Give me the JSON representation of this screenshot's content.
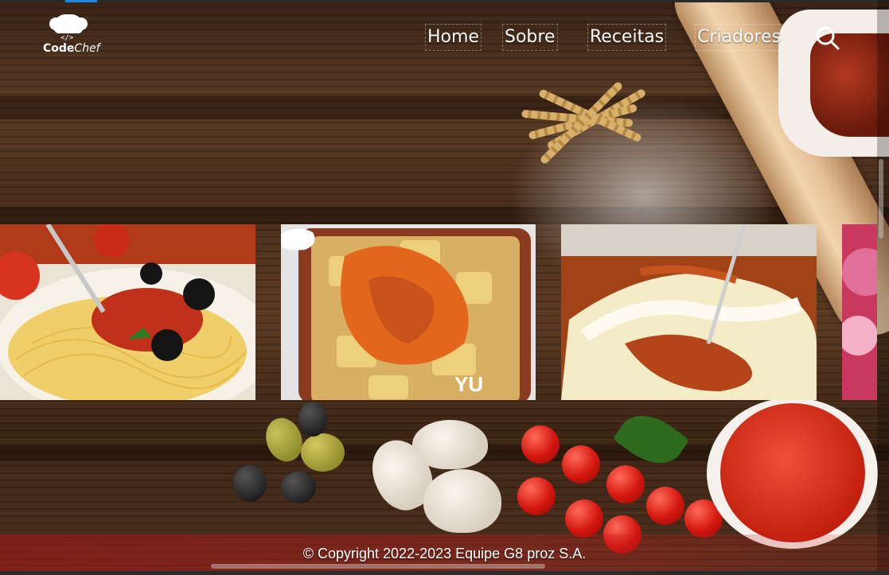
{
  "brand": {
    "logo_text_bold": "Code",
    "logo_text_light": "Chef",
    "logo_code_symbol": "</>"
  },
  "nav": {
    "items": [
      {
        "label": "Home"
      },
      {
        "label": "Sobre"
      },
      {
        "label": "Receitas"
      },
      {
        "label": "Criadores"
      }
    ],
    "search_icon": "search-icon"
  },
  "gallery": {
    "cards": [
      {
        "name": "spaghetti-photo",
        "overlay_text": ""
      },
      {
        "name": "patatas-bravas-photo",
        "overlay_text": "YU"
      },
      {
        "name": "pasta-bake-photo",
        "overlay_text": ""
      },
      {
        "name": "partial-dessert-photo",
        "overlay_text": ""
      }
    ]
  },
  "footer": {
    "copyright": "© Copyright 2022-2023 Equipe G8 proz S.A."
  },
  "colors": {
    "nav_text": "#ffffff",
    "footer_band": "#b41414",
    "accent_tab": "#1e88e5"
  }
}
